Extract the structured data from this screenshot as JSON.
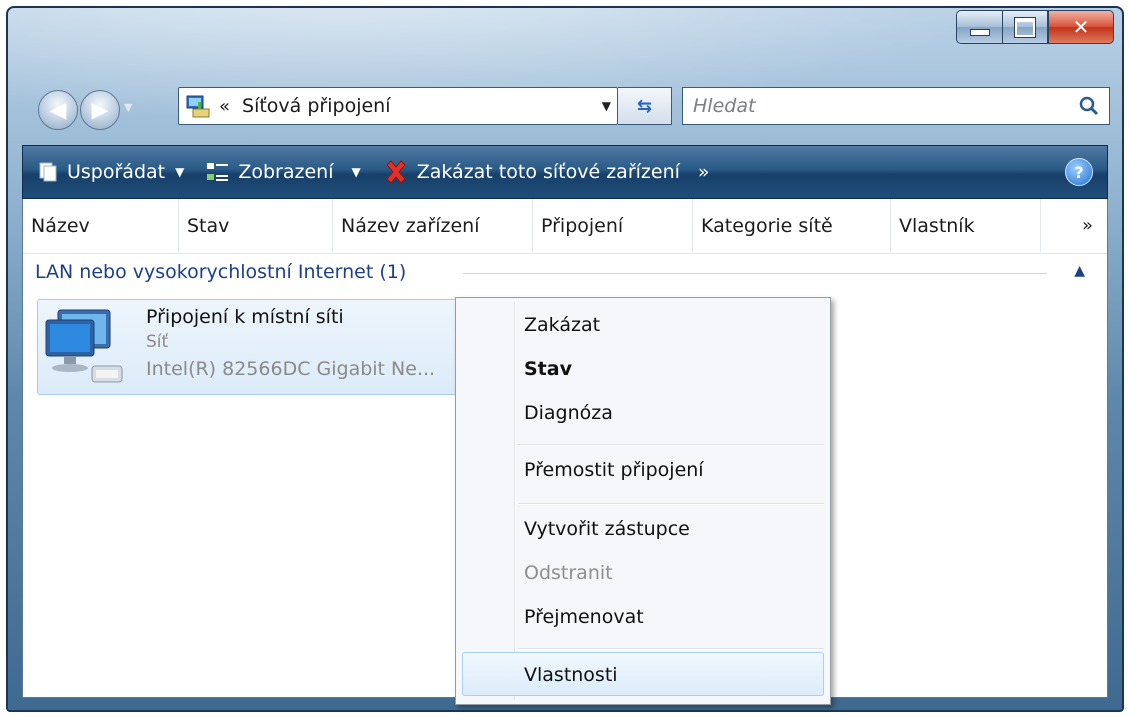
{
  "window": {
    "colors": {
      "frame": "#1d3553",
      "commandbar": "#1f4d79",
      "group_text": "#1e3f8a",
      "close": "#c2341a"
    }
  },
  "navigation": {
    "breadcrumb_prefix": "«",
    "address_text": "Síťová připojení",
    "search_placeholder": "Hledat",
    "back_icon": "back-arrow-icon",
    "forward_icon": "forward-arrow-icon"
  },
  "commandbar": {
    "organize": "Uspořádat",
    "views": "Zobrazení",
    "disable_device": "Zakázat toto síťové zařízení",
    "more": "»",
    "help": "?"
  },
  "columns": [
    "Název",
    "Stav",
    "Název zařízení",
    "Připojení",
    "Kategorie sítě",
    "Vlastník"
  ],
  "columns_more": "»",
  "group": {
    "label": "LAN nebo vysokorychlostní Internet (1)"
  },
  "item": {
    "name": "Připojení k místní síti",
    "status": "Síť",
    "device": "Intel(R) 82566DC Gigabit Ne..."
  },
  "context_menu": {
    "disable": "Zakázat",
    "status": "Stav",
    "diagnose": "Diagnóza",
    "bridge": "Přemostit připojení",
    "create_shortcut": "Vytvořit zástupce",
    "delete": "Odstranit",
    "rename": "Přejmenovat",
    "properties": "Vlastnosti"
  }
}
